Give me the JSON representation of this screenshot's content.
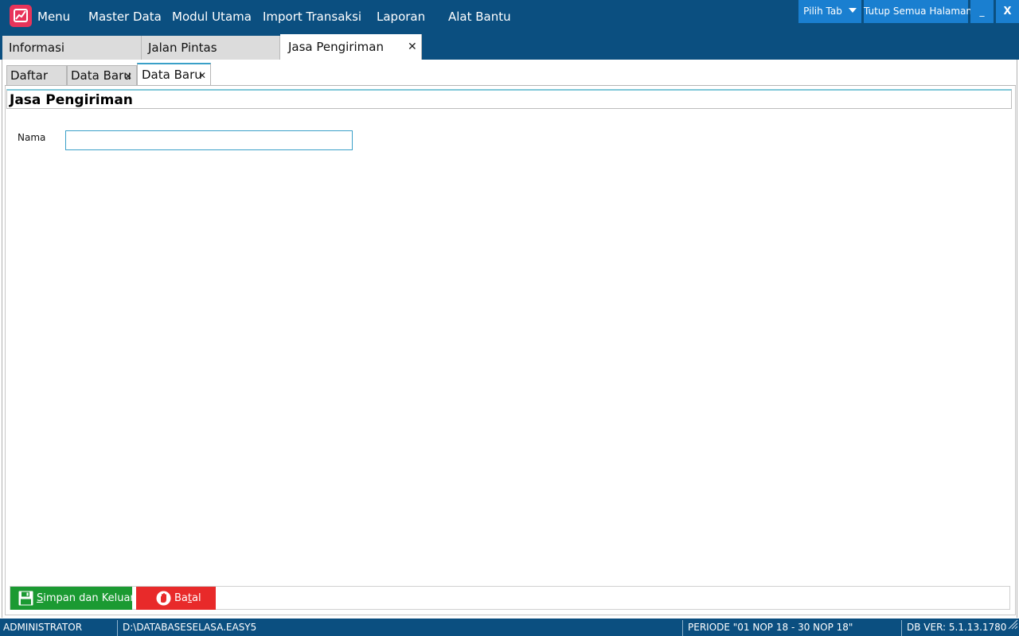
{
  "menubar": {
    "items": [
      "Menu",
      "Master Data",
      "Modul Utama",
      "Import Transaksi",
      "Laporan",
      "Alat Bantu"
    ],
    "pilih_tab_label": "Pilih Tab",
    "tutup_semua_label": "Tutup Semua Halaman",
    "minimize_label": "_",
    "close_label": "X",
    "logo_icon": "chart-logo-icon",
    "accent_color": "#0b4f80"
  },
  "main_tabs": [
    {
      "label": "Informasi",
      "active": false
    },
    {
      "label": "Jalan Pintas",
      "active": false
    },
    {
      "label": "Jasa Pengiriman",
      "active": true,
      "closable": true
    }
  ],
  "sub_tabs": [
    {
      "label": "Daftar",
      "active": false
    },
    {
      "label": "Data Baru",
      "active": false,
      "closable": true
    },
    {
      "label": "Data Baru",
      "active": true,
      "closable": true
    }
  ],
  "form": {
    "section_title": "Jasa Pengiriman",
    "fields": [
      {
        "label": "Nama",
        "value": "",
        "placeholder": ""
      }
    ]
  },
  "actions": {
    "save": {
      "prefix": "S",
      "rest": "impan dan Keluar",
      "icon": "floppy-disk-icon",
      "color": "#1b9a32"
    },
    "cancel": {
      "prefix": "Ba",
      "underlined": "t",
      "rest": "al",
      "icon": "stop-hand-icon",
      "color": "#e82a2a"
    }
  },
  "statusbar": {
    "user": "ADMINISTRATOR",
    "database": "D:\\DATABASESELASA.EASY5",
    "periode": "PERIODE \"01 NOP 18 - 30 NOP 18\"",
    "db_version": "DB VER: 5.1.13.1780"
  }
}
